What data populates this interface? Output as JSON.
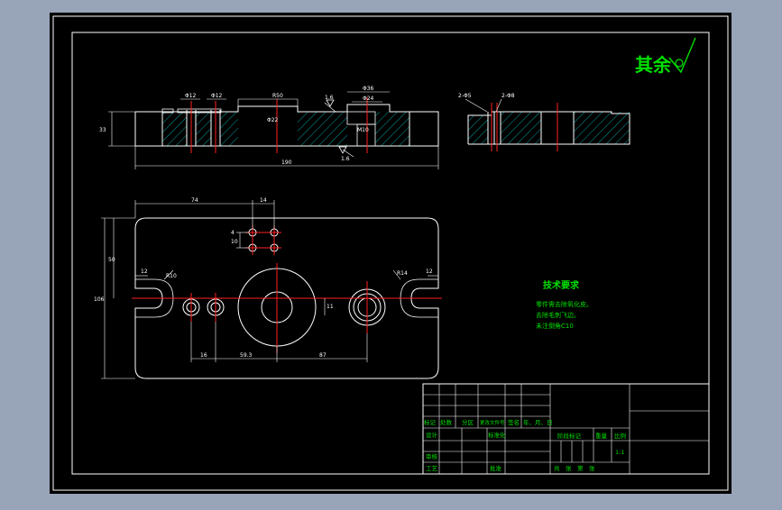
{
  "colors": {
    "background": "#98a4b8",
    "sheet": "#000000",
    "outline": "#ffffff",
    "centerline": "#ff2020",
    "hatch": "#00c8c8",
    "dimension": "#00d000",
    "table_text": "#00e000"
  },
  "surface_finish": {
    "label": "其余"
  },
  "front_view": {
    "dims": {
      "phi12_left": "Φ12",
      "phi12_right": "Φ12",
      "r50": "R50",
      "rough_top": "1.6",
      "phi36": "Φ36",
      "phi24": "Φ24",
      "height": "33",
      "phi22": "Φ22",
      "m10": "M10",
      "rough_bottom": "1.6",
      "length": "190"
    }
  },
  "side_view": {
    "dims": {
      "left": "2-Φ5",
      "right": "2-Φ8"
    }
  },
  "top_view": {
    "dims": {
      "d74": "74",
      "d14": "14",
      "d10": "10",
      "d4": "4",
      "d50": "50",
      "d12_left": "12",
      "r10": "R10",
      "d12_right": "12",
      "r14": "R14",
      "d106": "106",
      "d16": "16",
      "d59": "59.3",
      "d87": "87",
      "d11": "11"
    }
  },
  "tech_requirements": {
    "title": "技术要求",
    "lines": [
      "零件需去除氧化皮。",
      "去除毛刺飞边。",
      "未注倒角C10"
    ]
  },
  "title_block": {
    "row_labels": [
      "标记",
      "处数",
      "分区",
      "更改文件号",
      "签名",
      "年、月、日"
    ],
    "design": "设计",
    "standardize": "标准化",
    "stage_mark": "阶段标记",
    "weight": "重量",
    "scale": "比例",
    "scale_value": "1:1",
    "review": "审核",
    "process": "工艺",
    "approve": "批准",
    "sheets": "共　张　第　张"
  }
}
